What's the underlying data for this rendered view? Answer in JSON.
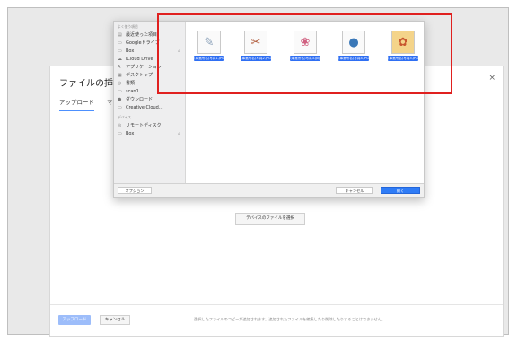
{
  "gdrive_dialog": {
    "title": "ファイルの挿入",
    "tab_upload": "アップロード",
    "tab_partial": "マ",
    "close": "×",
    "select_button": "デバイスのファイルを選択",
    "upload_button": "アップロード",
    "cancel_button": "キャンセル",
    "note": "選択したファイルのコピーが追加されます。追加されたファイルを編集したり削除したりすることはできません。",
    "upload_button_color": "#9dbdfa"
  },
  "mac_dialog": {
    "sidebar": {
      "favorites_header": "よく使う項目",
      "items": [
        {
          "label": "最近使った項目",
          "icon": "recent-icon"
        },
        {
          "label": "Googleドライブ",
          "icon": "folder-icon"
        },
        {
          "label": "Box",
          "icon": "folder-icon",
          "eject": "≐"
        },
        {
          "label": "iCloud Drive",
          "icon": "cloud-icon"
        },
        {
          "label": "アプリケーション",
          "icon": "applications-icon"
        },
        {
          "label": "デスクトップ",
          "icon": "desktop-icon"
        },
        {
          "label": "書類",
          "icon": "documents-icon"
        },
        {
          "label": "scan1",
          "icon": "folder-icon"
        },
        {
          "label": "ダウンロード",
          "icon": "download-icon"
        },
        {
          "label": "Creative Cloud...",
          "icon": "folder-icon"
        }
      ],
      "devices_header": "デバイス",
      "device_items": [
        {
          "label": "リモートディスク",
          "icon": "disc-icon"
        },
        {
          "label": "Box",
          "icon": "drive-icon",
          "eject": "≐"
        }
      ]
    },
    "files": [
      {
        "name": "(事業所名)写真1.JPG",
        "glyph": "✎"
      },
      {
        "name": "(事業所名)写真2.JPG",
        "glyph": "✂"
      },
      {
        "name": "(事業所名)写真3.jpg",
        "glyph": "❀"
      },
      {
        "name": "(事業所名)写真4.JPG",
        "glyph": "●"
      },
      {
        "name": "(事業所名)写真5.JPG",
        "glyph": "✿"
      }
    ],
    "options_button": "オプション",
    "cancel_button": "キャンセル",
    "open_button": "開く",
    "selection_color": "#2f6ff3",
    "highlight_color": "#e0201f"
  }
}
